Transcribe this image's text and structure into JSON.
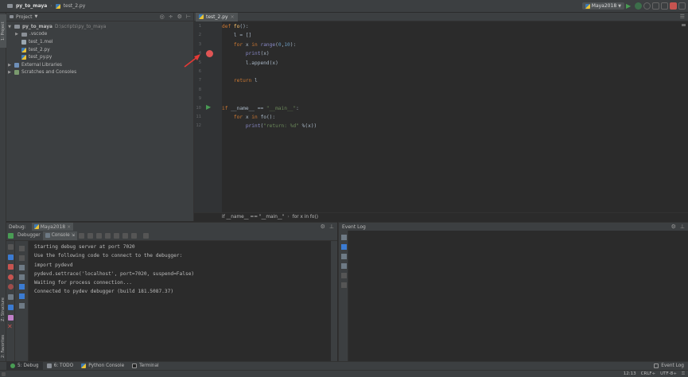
{
  "titlebar": {
    "project": "py_to_maya",
    "file": "test_2.py",
    "run_config": "Maya2018"
  },
  "project_panel": {
    "title": "Project",
    "tree": [
      {
        "label": "py_to_maya",
        "path": "D:\\scripts\\py_to_maya",
        "kind": "folder",
        "expanded": true,
        "indent": 0
      },
      {
        "label": ".vscode",
        "kind": "folder",
        "expanded": false,
        "indent": 1
      },
      {
        "label": "test_1.mel",
        "kind": "file",
        "indent": 1
      },
      {
        "label": "test_2.py",
        "kind": "py",
        "indent": 1
      },
      {
        "label": "test_py.py",
        "kind": "py",
        "indent": 1
      },
      {
        "label": "External Libraries",
        "kind": "lib",
        "expanded": false,
        "indent": 0
      },
      {
        "label": "Scratches and Consoles",
        "kind": "scratch",
        "expanded": false,
        "indent": 0
      }
    ]
  },
  "editor": {
    "tab_label": "test_2.py",
    "lines": [
      {
        "n": "1",
        "code": "def fo():"
      },
      {
        "n": "2",
        "code": "    l = []"
      },
      {
        "n": "3",
        "code": "    for x in range(0,10):"
      },
      {
        "n": "4",
        "code": "        print(x)"
      },
      {
        "n": "5",
        "code": "        l.append(x)"
      },
      {
        "n": "6",
        "code": ""
      },
      {
        "n": "7",
        "code": "    return l"
      },
      {
        "n": "8",
        "code": ""
      },
      {
        "n": "9",
        "code": ""
      },
      {
        "n": "10",
        "code": "if __name__ == \"__main__\":"
      },
      {
        "n": "11",
        "code": "    for x in fo():"
      },
      {
        "n": "12",
        "code": "        print(\"return: %d\" %(x))"
      }
    ],
    "breadcrumb": [
      "if __name__ == \"__main__\"",
      "for x in fo()"
    ]
  },
  "debug_panel": {
    "title": "Debug:",
    "session_tab": "Maya2018",
    "tab_debugger": "Debugger",
    "tab_console": "Console",
    "console_lines": [
      "Starting debug server at port 7020",
      "Use the following code to connect to the debugger:",
      "import pydevd",
      "pydevd.settrace('localhost', port=7020, suspend=False)",
      "Waiting for process connection...",
      "Connected to pydev debugger (build 181.5087.37)"
    ]
  },
  "event_log": {
    "title": "Event Log"
  },
  "left_strip": {
    "project_tab": "1: Project",
    "structure_tab": "Z: Structure",
    "favorites_tab": "2: Favorites"
  },
  "bottom_tabs": {
    "debug": "5: Debug",
    "todo": "6: TODO",
    "python_console": "Python Console",
    "terminal": "Terminal",
    "event_log": "Event Log"
  },
  "status": {
    "position": "12:13",
    "line_sep": "CRLF÷",
    "encoding": "UTF-8÷"
  },
  "colors": {
    "breakpoint": "#e05555",
    "run_arrow": "#499c54",
    "annotation_arrow": "#e53935"
  }
}
